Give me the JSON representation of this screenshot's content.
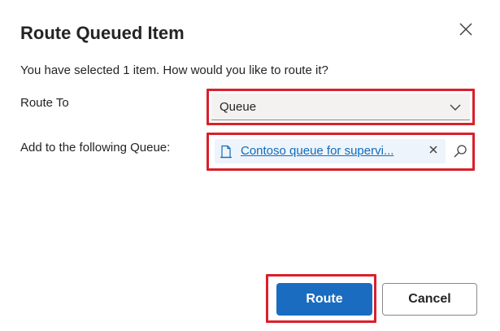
{
  "dialog": {
    "title": "Route Queued Item",
    "intro": "You have selected 1 item. How would you like to route it?",
    "route_to": {
      "label": "Route To",
      "selected": "Queue"
    },
    "queue": {
      "label": "Add to the following Queue:",
      "selected_value": "Contoso queue for supervi..."
    },
    "buttons": {
      "primary": "Route",
      "secondary": "Cancel"
    }
  },
  "colors": {
    "primary_button": "#1a6cc0",
    "link": "#0f6cbd",
    "highlight_box": "#d9202b",
    "select_background": "#f3f2f1",
    "chip_background": "#eef4fb"
  },
  "icons": {
    "close": "close-icon",
    "dropdown": "chevron-down-icon",
    "record": "document-icon",
    "remove": "remove-icon",
    "lookup": "search-icon"
  }
}
